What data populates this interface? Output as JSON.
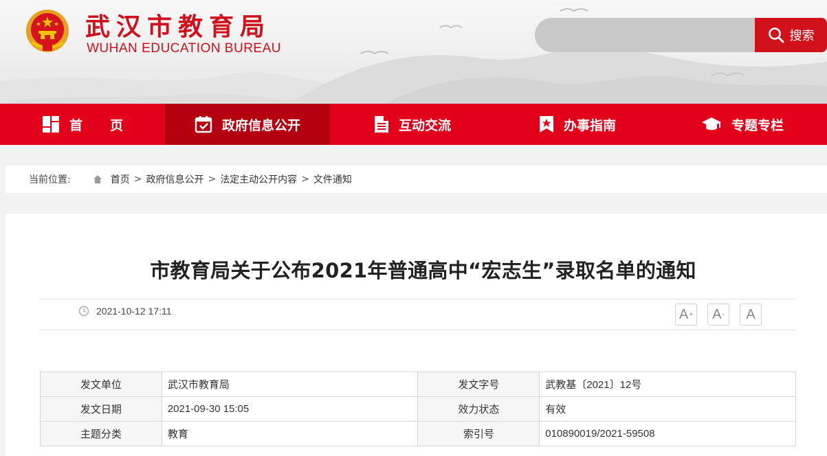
{
  "header": {
    "title_cn": "武汉市教育局",
    "title_en": "WUHAN EDUCATION BUREAU",
    "emblem_icon": "national-emblem-icon",
    "search": {
      "placeholder": "",
      "button_label": "搜索",
      "button_icon": "search-icon"
    },
    "colors": {
      "brand_red": "#d0101a",
      "nav_red": "#e3001b",
      "nav_active": "#b5000f"
    }
  },
  "nav": {
    "items": [
      {
        "label": "首页",
        "icon": "grid-icon"
      },
      {
        "label": "政府信息公开",
        "icon": "calendar-check-icon"
      },
      {
        "label": "互动交流",
        "icon": "document-icon"
      },
      {
        "label": "办事指南",
        "icon": "bookmark-star-icon"
      },
      {
        "label": "专题专栏",
        "icon": "graduation-cap-icon"
      }
    ]
  },
  "breadcrumb": {
    "prefix": "当前位置:",
    "items": [
      "首页",
      "政府信息公开",
      "法定主动公开内容",
      "文件通知"
    ],
    "separator": ">"
  },
  "article": {
    "title": "市教育局关于公布2021年普通高中“宏志生”录取名单的通知",
    "published": "2021-10-12 17:11",
    "font_size_buttons": [
      "A",
      "A",
      "A"
    ]
  },
  "info_table": {
    "rows": [
      {
        "k1": "发文单位",
        "v1": "武汉市教育局",
        "k2": "发文字号",
        "v2": "武教基〔2021〕12号"
      },
      {
        "k1": "发文日期",
        "v1": "2021-09-30 15:05",
        "k2": "效力状态",
        "v2": "有效"
      },
      {
        "k1": "主题分类",
        "v1": "教育",
        "k2": "索引号",
        "v2": "010890019/2021-59508"
      }
    ]
  }
}
